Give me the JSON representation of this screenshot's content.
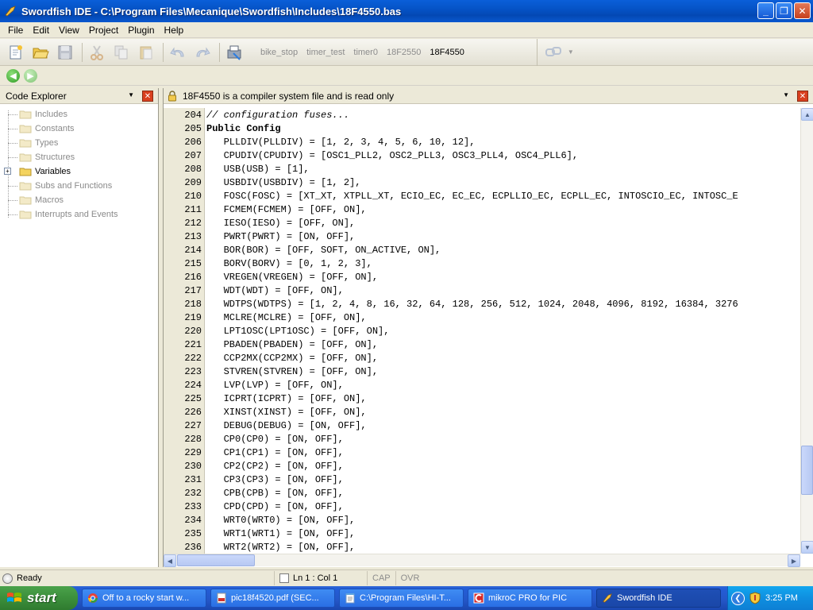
{
  "window": {
    "title": "Swordfish IDE - C:\\Program Files\\Mecanique\\Swordfish\\Includes\\18F4550.bas",
    "minimize": "_",
    "maximize": "❐",
    "close": "✕"
  },
  "menu": [
    "File",
    "Edit",
    "View",
    "Project",
    "Plugin",
    "Help"
  ],
  "toolbar": {
    "tabs": [
      "bike_stop",
      "timer_test",
      "timer0",
      "18F2550",
      "18F4550"
    ],
    "active_tab": 4
  },
  "explorer": {
    "title": "Code Explorer",
    "items": [
      {
        "label": "Includes",
        "active": false
      },
      {
        "label": "Constants",
        "active": false
      },
      {
        "label": "Types",
        "active": false
      },
      {
        "label": "Structures",
        "active": false
      },
      {
        "label": "Variables",
        "active": true,
        "expandable": true
      },
      {
        "label": "Subs and Functions",
        "active": false
      },
      {
        "label": "Macros",
        "active": false
      },
      {
        "label": "Interrupts and Events",
        "active": false
      }
    ]
  },
  "editor": {
    "notice": "18F4550 is a compiler system file and is read only",
    "lines": [
      {
        "no": "204",
        "text": "// configuration fuses...",
        "style": "comment"
      },
      {
        "no": "205",
        "text": "Public Config",
        "style": "bold"
      },
      {
        "no": "206",
        "text": "   PLLDIV(PLLDIV) = [1, 2, 3, 4, 5, 6, 10, 12],",
        "style": ""
      },
      {
        "no": "207",
        "text": "   CPUDIV(CPUDIV) = [OSC1_PLL2, OSC2_PLL3, OSC3_PLL4, OSC4_PLL6],",
        "style": ""
      },
      {
        "no": "208",
        "text": "   USB(USB) = [1],",
        "style": ""
      },
      {
        "no": "209",
        "text": "   USBDIV(USBDIV) = [1, 2],",
        "style": ""
      },
      {
        "no": "210",
        "text": "   FOSC(FOSC) = [XT_XT, XTPLL_XT, ECIO_EC, EC_EC, ECPLLIO_EC, ECPLL_EC, INTOSCIO_EC, INTOSC_E",
        "style": ""
      },
      {
        "no": "211",
        "text": "   FCMEM(FCMEM) = [OFF, ON],",
        "style": ""
      },
      {
        "no": "212",
        "text": "   IESO(IESO) = [OFF, ON],",
        "style": ""
      },
      {
        "no": "213",
        "text": "   PWRT(PWRT) = [ON, OFF],",
        "style": ""
      },
      {
        "no": "214",
        "text": "   BOR(BOR) = [OFF, SOFT, ON_ACTIVE, ON],",
        "style": ""
      },
      {
        "no": "215",
        "text": "   BORV(BORV) = [0, 1, 2, 3],",
        "style": ""
      },
      {
        "no": "216",
        "text": "   VREGEN(VREGEN) = [OFF, ON],",
        "style": ""
      },
      {
        "no": "217",
        "text": "   WDT(WDT) = [OFF, ON],",
        "style": ""
      },
      {
        "no": "218",
        "text": "   WDTPS(WDTPS) = [1, 2, 4, 8, 16, 32, 64, 128, 256, 512, 1024, 2048, 4096, 8192, 16384, 3276",
        "style": ""
      },
      {
        "no": "219",
        "text": "   MCLRE(MCLRE) = [OFF, ON],",
        "style": ""
      },
      {
        "no": "220",
        "text": "   LPT1OSC(LPT1OSC) = [OFF, ON],",
        "style": ""
      },
      {
        "no": "221",
        "text": "   PBADEN(PBADEN) = [OFF, ON],",
        "style": ""
      },
      {
        "no": "222",
        "text": "   CCP2MX(CCP2MX) = [OFF, ON],",
        "style": ""
      },
      {
        "no": "223",
        "text": "   STVREN(STVREN) = [OFF, ON],",
        "style": ""
      },
      {
        "no": "224",
        "text": "   LVP(LVP) = [OFF, ON],",
        "style": ""
      },
      {
        "no": "225",
        "text": "   ICPRT(ICPRT) = [OFF, ON],",
        "style": ""
      },
      {
        "no": "226",
        "text": "   XINST(XINST) = [OFF, ON],",
        "style": ""
      },
      {
        "no": "227",
        "text": "   DEBUG(DEBUG) = [ON, OFF],",
        "style": ""
      },
      {
        "no": "228",
        "text": "   CP0(CP0) = [ON, OFF],",
        "style": ""
      },
      {
        "no": "229",
        "text": "   CP1(CP1) = [ON, OFF],",
        "style": ""
      },
      {
        "no": "230",
        "text": "   CP2(CP2) = [ON, OFF],",
        "style": ""
      },
      {
        "no": "231",
        "text": "   CP3(CP3) = [ON, OFF],",
        "style": ""
      },
      {
        "no": "232",
        "text": "   CPB(CPB) = [ON, OFF],",
        "style": ""
      },
      {
        "no": "233",
        "text": "   CPD(CPD) = [ON, OFF],",
        "style": ""
      },
      {
        "no": "234",
        "text": "   WRT0(WRT0) = [ON, OFF],",
        "style": ""
      },
      {
        "no": "235",
        "text": "   WRT1(WRT1) = [ON, OFF],",
        "style": ""
      },
      {
        "no": "236",
        "text": "   WRT2(WRT2) = [ON, OFF],",
        "style": ""
      }
    ]
  },
  "status": {
    "ready": "Ready",
    "position": "Ln 1 : Col 1",
    "cap": "CAP",
    "ovr": "OVR"
  },
  "taskbar": {
    "start": "start",
    "tasks": [
      {
        "label": "Off to a rocky start w...",
        "icon": "chrome-icon",
        "active": false
      },
      {
        "label": "pic18f4520.pdf (SEC...",
        "icon": "pdf-icon",
        "active": false
      },
      {
        "label": "C:\\Program Files\\HI-T...",
        "icon": "notepad-icon",
        "active": false
      },
      {
        "label": "mikroC PRO for PIC",
        "icon": "mikroc-icon",
        "active": false
      },
      {
        "label": "Swordfish IDE",
        "icon": "swordfish-icon",
        "active": true
      }
    ],
    "clock": "3:25 PM"
  }
}
